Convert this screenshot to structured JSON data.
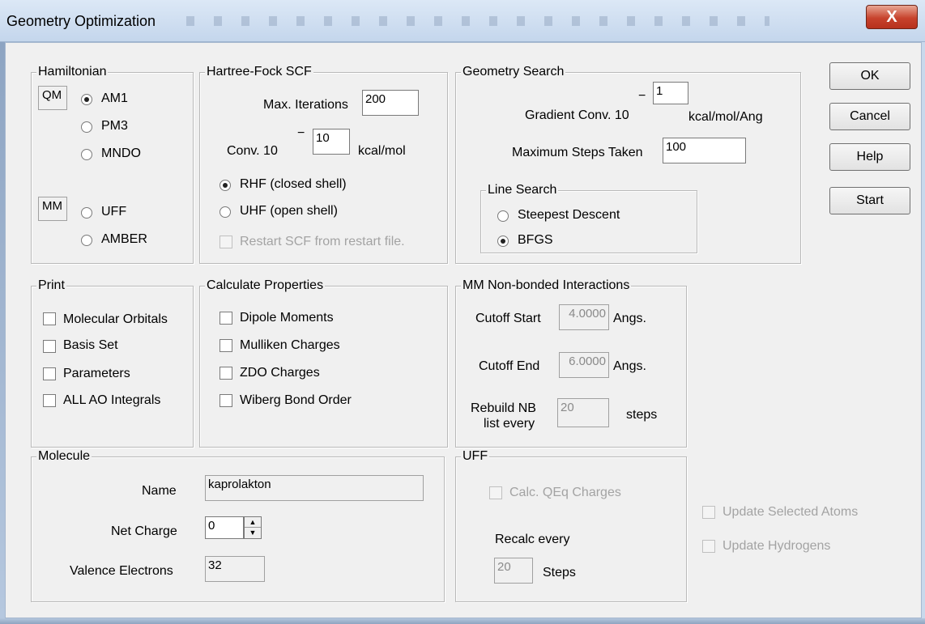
{
  "window": {
    "title": "Geometry Optimization",
    "close_label": "X"
  },
  "buttons": {
    "ok": "OK",
    "cancel": "Cancel",
    "help": "Help",
    "start": "Start"
  },
  "hamiltonian": {
    "legend": "Hamiltonian",
    "qm_label": "QM",
    "mm_label": "MM",
    "am1": "AM1",
    "pm3": "PM3",
    "mndo": "MNDO",
    "uff": "UFF",
    "amber": "AMBER",
    "selected": "AM1"
  },
  "scf": {
    "legend": "Hartree-Fock SCF",
    "max_iter_label": "Max. Iterations",
    "max_iter_value": "200",
    "conv_label": "Conv. 10",
    "conv_exp_sign": "−",
    "conv_exp_value": "10",
    "conv_unit": "kcal/mol",
    "rhf": "RHF (closed shell)",
    "uhf": "UHF (open shell)",
    "restart": "Restart SCF from restart file.",
    "selected": "RHF (closed shell)"
  },
  "geometry": {
    "legend": "Geometry Search",
    "grad_label": "Gradient Conv. 10",
    "grad_exp_sign": "−",
    "grad_exp_value": "1",
    "grad_unit": "kcal/mol/Ang",
    "max_steps_label": "Maximum Steps Taken",
    "max_steps_value": "100",
    "line_search": {
      "legend": "Line Search",
      "steepest": "Steepest Descent",
      "bfgs": "BFGS",
      "selected": "BFGS"
    }
  },
  "print": {
    "legend": "Print",
    "items": [
      "Molecular Orbitals",
      "Basis Set",
      "Parameters",
      "ALL AO Integrals"
    ]
  },
  "properties": {
    "legend": "Calculate Properties",
    "items": [
      "Dipole Moments",
      "Mulliken Charges",
      "ZDO Charges",
      "Wiberg Bond Order"
    ]
  },
  "mm": {
    "legend": "MM Non-bonded Interactions",
    "cutoff_start_label": "Cutoff Start",
    "cutoff_start_value": "4.0000",
    "cutoff_start_unit": "Angs.",
    "cutoff_end_label": "Cutoff End",
    "cutoff_end_value": "6.0000",
    "cutoff_end_unit": "Angs.",
    "rebuild_label_1": "Rebuild NB",
    "rebuild_label_2": "list every",
    "rebuild_value": "20",
    "rebuild_unit": "steps"
  },
  "molecule": {
    "legend": "Molecule",
    "name_label": "Name",
    "name_value": "kaprolakton",
    "net_charge_label": "Net Charge",
    "net_charge_value": "0",
    "valence_label": "Valence Electrons",
    "valence_value": "32"
  },
  "uff": {
    "legend": "UFF",
    "calc_qeq": "Calc. QEq Charges",
    "recalc_label": "Recalc every",
    "recalc_value": "20",
    "recalc_unit": "Steps"
  },
  "extra": {
    "update_selected": "Update Selected Atoms",
    "update_hydrogens": "Update Hydrogens"
  }
}
